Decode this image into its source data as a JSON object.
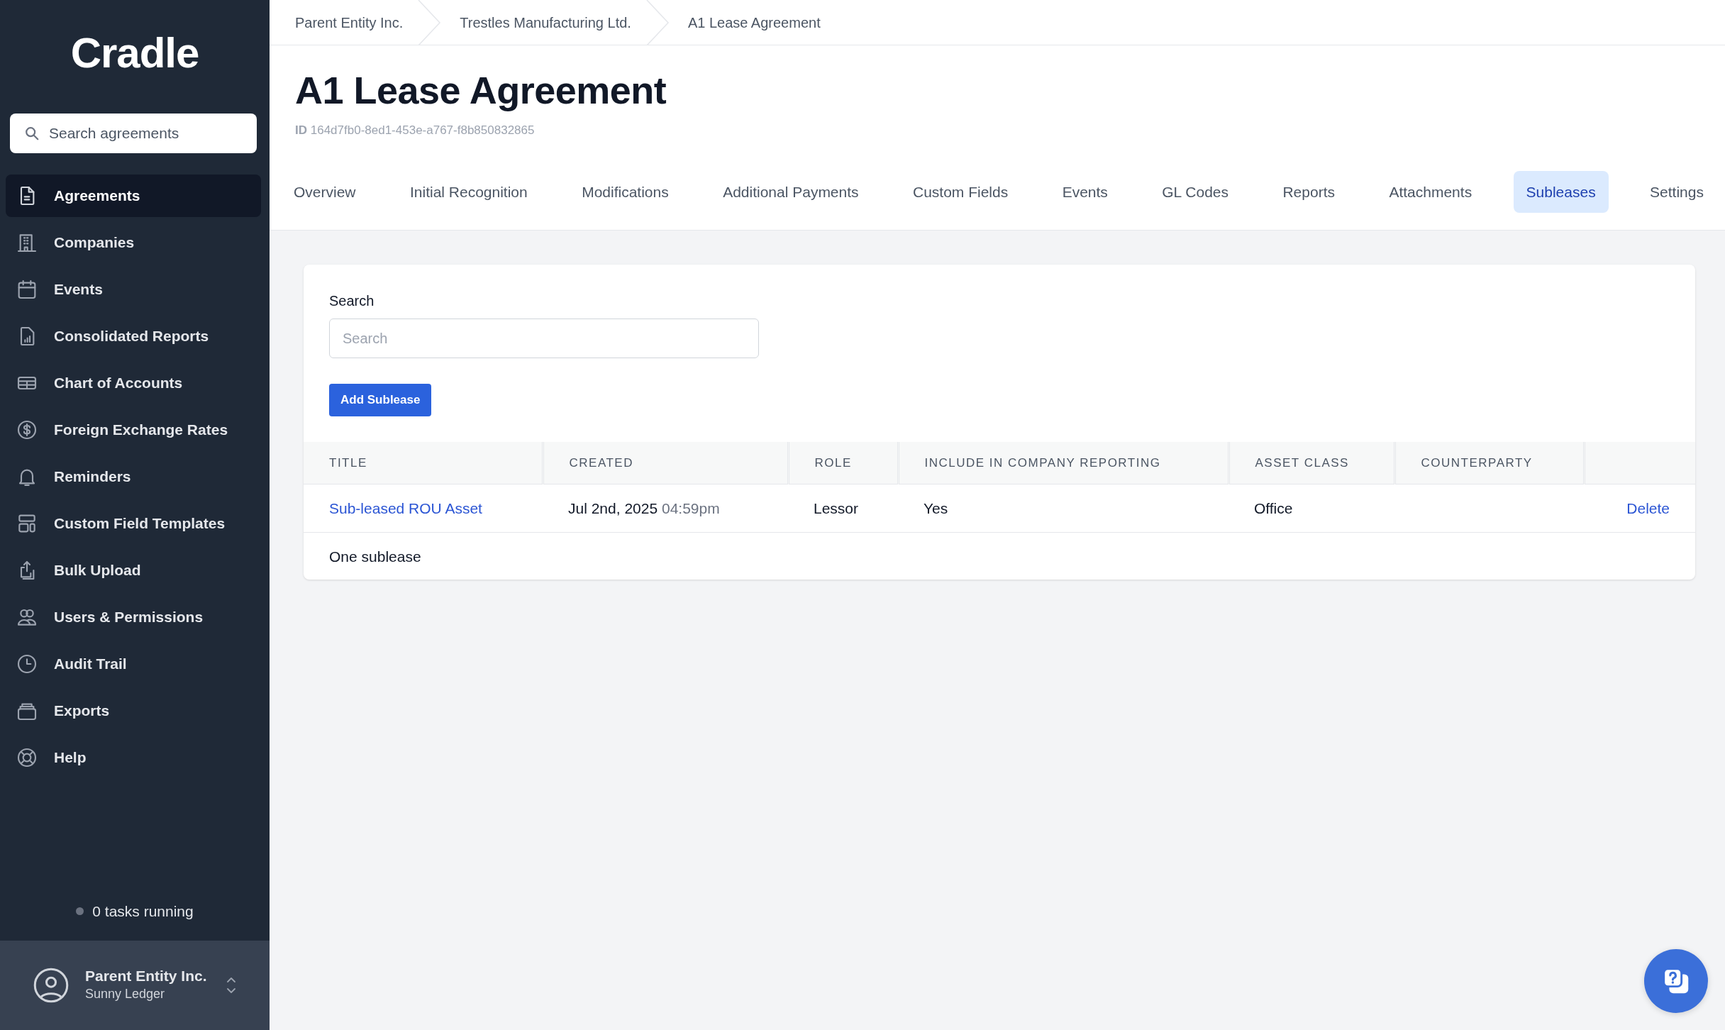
{
  "sidebar": {
    "logo": "Cradle",
    "search": {
      "placeholder": "Search agreements"
    },
    "items": [
      {
        "label": "Agreements",
        "selected": true
      },
      {
        "label": "Companies",
        "selected": false
      },
      {
        "label": "Events",
        "selected": false
      },
      {
        "label": "Consolidated Reports",
        "selected": false
      },
      {
        "label": "Chart of Accounts",
        "selected": false
      },
      {
        "label": "Foreign Exchange Rates",
        "selected": false
      },
      {
        "label": "Reminders",
        "selected": false
      },
      {
        "label": "Custom Field Templates",
        "selected": false
      },
      {
        "label": "Bulk Upload",
        "selected": false
      },
      {
        "label": "Users & Permissions",
        "selected": false
      },
      {
        "label": "Audit Trail",
        "selected": false
      },
      {
        "label": "Exports",
        "selected": false
      },
      {
        "label": "Help",
        "selected": false
      }
    ],
    "tasks": "0 tasks running",
    "account": {
      "name": "Parent Entity Inc.",
      "subtitle": "Sunny Ledger"
    }
  },
  "breadcrumbs": [
    "Parent Entity Inc.",
    "Trestles Manufacturing Ltd.",
    "A1 Lease Agreement"
  ],
  "title": "A1 Lease Agreement",
  "id": {
    "label": "ID",
    "value": "164d7fb0-8ed1-453e-a767-f8b850832865"
  },
  "tabs": [
    {
      "label": "Overview",
      "selected": false
    },
    {
      "label": "Initial Recognition",
      "selected": false
    },
    {
      "label": "Modifications",
      "selected": false
    },
    {
      "label": "Additional Payments",
      "selected": false
    },
    {
      "label": "Custom Fields",
      "selected": false
    },
    {
      "label": "Events",
      "selected": false
    },
    {
      "label": "GL Codes",
      "selected": false
    },
    {
      "label": "Reports",
      "selected": false
    },
    {
      "label": "Attachments",
      "selected": false
    },
    {
      "label": "Subleases",
      "selected": true
    },
    {
      "label": "Settings",
      "selected": false
    }
  ],
  "panel": {
    "search_label": "Search",
    "search": {
      "placeholder": "Search"
    },
    "add_button": "Add Sublease",
    "table": {
      "columns": [
        "TITLE",
        "CREATED",
        "ROLE",
        "INCLUDE IN COMPANY REPORTING",
        "ASSET CLASS",
        "COUNTERPARTY"
      ],
      "rows": [
        {
          "title": "Sub-leased ROU Asset",
          "created_date": "Jul 2nd, 2025",
          "created_time": "04:59pm",
          "role": "Lessor",
          "include": "Yes",
          "asset_class": "Office",
          "action": "Delete"
        }
      ]
    },
    "footer": "One sublease"
  }
}
